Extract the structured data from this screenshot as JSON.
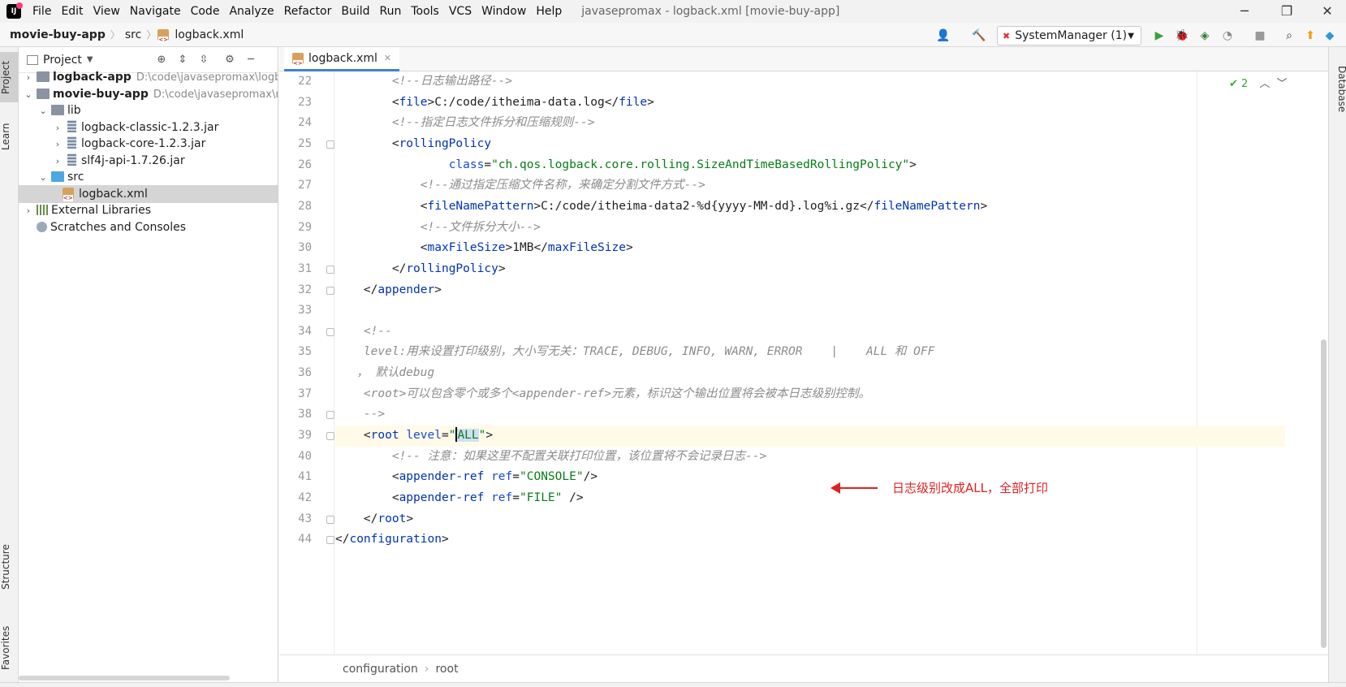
{
  "titlebar": {
    "logo": "IJ",
    "menu": [
      "File",
      "Edit",
      "View",
      "Navigate",
      "Code",
      "Analyze",
      "Refactor",
      "Build",
      "Run",
      "Tools",
      "VCS",
      "Window",
      "Help"
    ],
    "window_title": "javasepromax - logback.xml [movie-buy-app]",
    "minimize": "─",
    "maximize": "❐",
    "close": "✕"
  },
  "navbar": {
    "crumbs": [
      "movie-buy-app",
      "src",
      "logback.xml"
    ],
    "run_config": "SystemManager (1)"
  },
  "left_strip": {
    "project": "Project",
    "learn": "Learn",
    "structure": "Structure",
    "favorites": "Favorites"
  },
  "right_strip": {
    "database": "Database"
  },
  "project_panel": {
    "title": "Project",
    "tree": [
      {
        "label": "logback-app",
        "hint": "D:\\code\\javasepromax\\logba"
      },
      {
        "label": "movie-buy-app",
        "hint": "D:\\code\\javasepromax\\mo"
      },
      {
        "label": "lib"
      },
      {
        "label": "logback-classic-1.2.3.jar"
      },
      {
        "label": "logback-core-1.2.3.jar"
      },
      {
        "label": "slf4j-api-1.7.26.jar"
      },
      {
        "label": "src"
      },
      {
        "label": "logback.xml"
      },
      {
        "label": "External Libraries"
      },
      {
        "label": "Scratches and Consoles"
      }
    ]
  },
  "editor": {
    "tab": "logback.xml",
    "inspection_count": "2",
    "line_numbers": [
      "22",
      "23",
      "24",
      "25",
      "26",
      "27",
      "28",
      "29",
      "30",
      "31",
      "32",
      "33",
      "34",
      "35",
      "36",
      "37",
      "38",
      "39",
      "40",
      "41",
      "42",
      "43",
      "44"
    ],
    "annotation": "日志级别改成ALL，全部打印",
    "breadcrumbs": [
      "configuration",
      "root"
    ]
  }
}
